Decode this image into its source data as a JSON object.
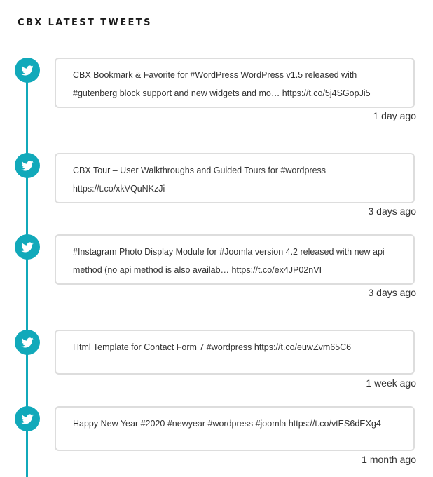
{
  "widget": {
    "title": "CBX LATEST TWEETS"
  },
  "colors": {
    "accent": "#11a9ba",
    "card_border": "#dddddd"
  },
  "icon": "twitter-bird-icon",
  "tweets": [
    {
      "text": "CBX Bookmark & Favorite for #WordPress WordPress v1.5 released with #gutenberg block support and new widgets and mo… https://t.co/5j4SGopJi5",
      "time": "1 day ago"
    },
    {
      "text": "CBX Tour – User Walkthroughs and Guided Tours for #wordpress https://t.co/xkVQuNKzJi",
      "time": "3 days ago"
    },
    {
      "text": "#Instagram Photo Display Module for #Joomla version 4.2 released with new api method (no api method is also availab… https://t.co/ex4JP02nVI",
      "time": "3 days ago"
    },
    {
      "text": "Html Template for Contact Form 7 #wordpress https://t.co/euwZvm65C6",
      "time": "1 week ago"
    },
    {
      "text": "Happy New Year #2020 #newyear #wordpress #joomla https://t.co/vtES6dEXg4",
      "time": "1 month ago"
    }
  ]
}
